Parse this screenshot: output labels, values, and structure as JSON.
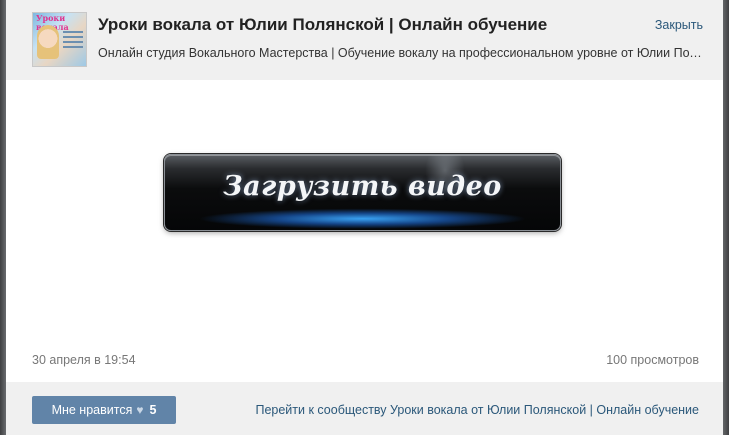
{
  "header": {
    "avatar_text": "Уроки вокала",
    "title": "Уроки вокала от Юлии Полянской | Онлайн обучение",
    "subtitle": "Онлайн студия Вокального Мастерства | Обучение вокалу на профессиональном уровне от Юлии Полянской",
    "close_label": "Закрыть"
  },
  "video": {
    "upload_button_label": "Загрузить видео"
  },
  "meta": {
    "date": "30 апреля в 19:54",
    "views": "100 просмотров"
  },
  "footer": {
    "like_label": "Мне нравится",
    "like_icon": "heart-icon",
    "like_count": "5",
    "community_link": "Перейти к сообществу Уроки вокала от Юлии Полянской | Онлайн обучение"
  },
  "colors": {
    "link": "#2b587a",
    "like_button": "#6184a8",
    "header_bg": "#f0f0f0"
  }
}
